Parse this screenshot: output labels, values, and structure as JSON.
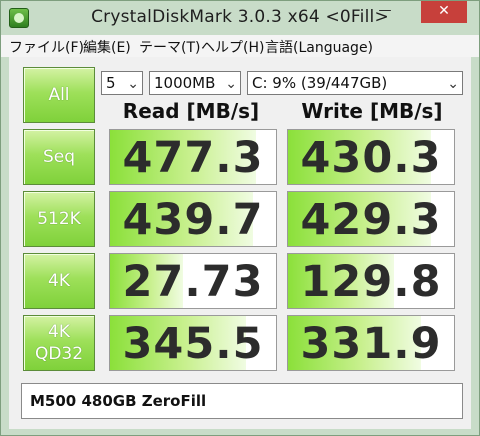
{
  "window": {
    "title": "CrystalDiskMark 3.0.3 x64 <0Fill>",
    "min_symbol": "—",
    "max_symbol": "☐",
    "close_symbol": "✕"
  },
  "menu": [
    {
      "label": "ファイル(F)"
    },
    {
      "label": "編集(E)"
    },
    {
      "label": "テーマ(T)"
    },
    {
      "label": "ヘルプ(H)"
    },
    {
      "label": "言語(Language)"
    }
  ],
  "controls": {
    "all_label": "All",
    "runs": "5",
    "size": "1000MB",
    "drive": "C: 9% (39/447GB)"
  },
  "columns": {
    "read": "Read [MB/s]",
    "write": "Write [MB/s]"
  },
  "tests": [
    {
      "label1": "Seq",
      "label2": "",
      "read": "477.3",
      "write": "430.3",
      "read_fill": 0.88,
      "write_fill": 0.86
    },
    {
      "label1": "512K",
      "label2": "",
      "read": "439.7",
      "write": "429.3",
      "read_fill": 0.86,
      "write_fill": 0.86
    },
    {
      "label1": "4K",
      "label2": "",
      "read": "27.73",
      "write": "129.8",
      "read_fill": 0.44,
      "write_fill": 0.64
    },
    {
      "label1": "4K",
      "label2": "QD32",
      "read": "345.5",
      "write": "331.9",
      "read_fill": 0.82,
      "write_fill": 0.8
    }
  ],
  "comment": "M500 480GB ZeroFill",
  "colors": {
    "accent_green": "#8be03a",
    "close_red": "#c7403b"
  }
}
